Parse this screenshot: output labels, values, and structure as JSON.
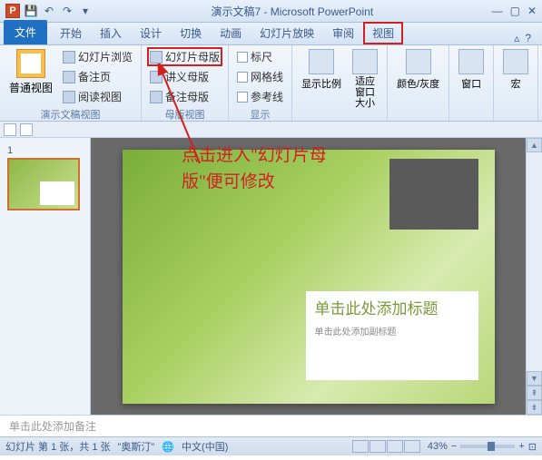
{
  "title": "演示文稿7 - Microsoft PowerPoint",
  "app_icon": "P",
  "tabs": {
    "file": "文件",
    "items": [
      "开始",
      "插入",
      "设计",
      "切换",
      "动画",
      "幻灯片放映",
      "审阅",
      "视图"
    ],
    "highlighted": "视图"
  },
  "ribbon": {
    "group_views": {
      "label": "演示文稿视图",
      "normal": "普通视图",
      "sorter": "幻灯片浏览",
      "notes_page": "备注页",
      "reading": "阅读视图"
    },
    "group_master": {
      "label": "母版视图",
      "slide_master": "幻灯片母版",
      "handout_master": "讲义母版",
      "notes_master": "备注母版"
    },
    "group_show": {
      "label": "显示",
      "ruler": "标尺",
      "gridlines": "网格线",
      "guides": "参考线"
    },
    "group_zoom": {
      "zoom": "显示比例",
      "fit": "适应窗口大小"
    },
    "group_color": {
      "label": "颜色/灰度"
    },
    "group_window": {
      "label": "窗口"
    },
    "group_macro": {
      "label": "宏"
    }
  },
  "annotation": "点击进入\"幻灯片母版\"便可修改",
  "slide": {
    "title_placeholder": "单击此处添加标题",
    "subtitle_placeholder": "单击此处添加副标题"
  },
  "notes_placeholder": "单击此处添加备注",
  "status": {
    "slide_info": "幻灯片 第 1 张，共 1 张",
    "theme": "\"奥斯汀\"",
    "lang": "中文(中国)",
    "zoom": "43%"
  },
  "thumb": {
    "num": "1"
  }
}
